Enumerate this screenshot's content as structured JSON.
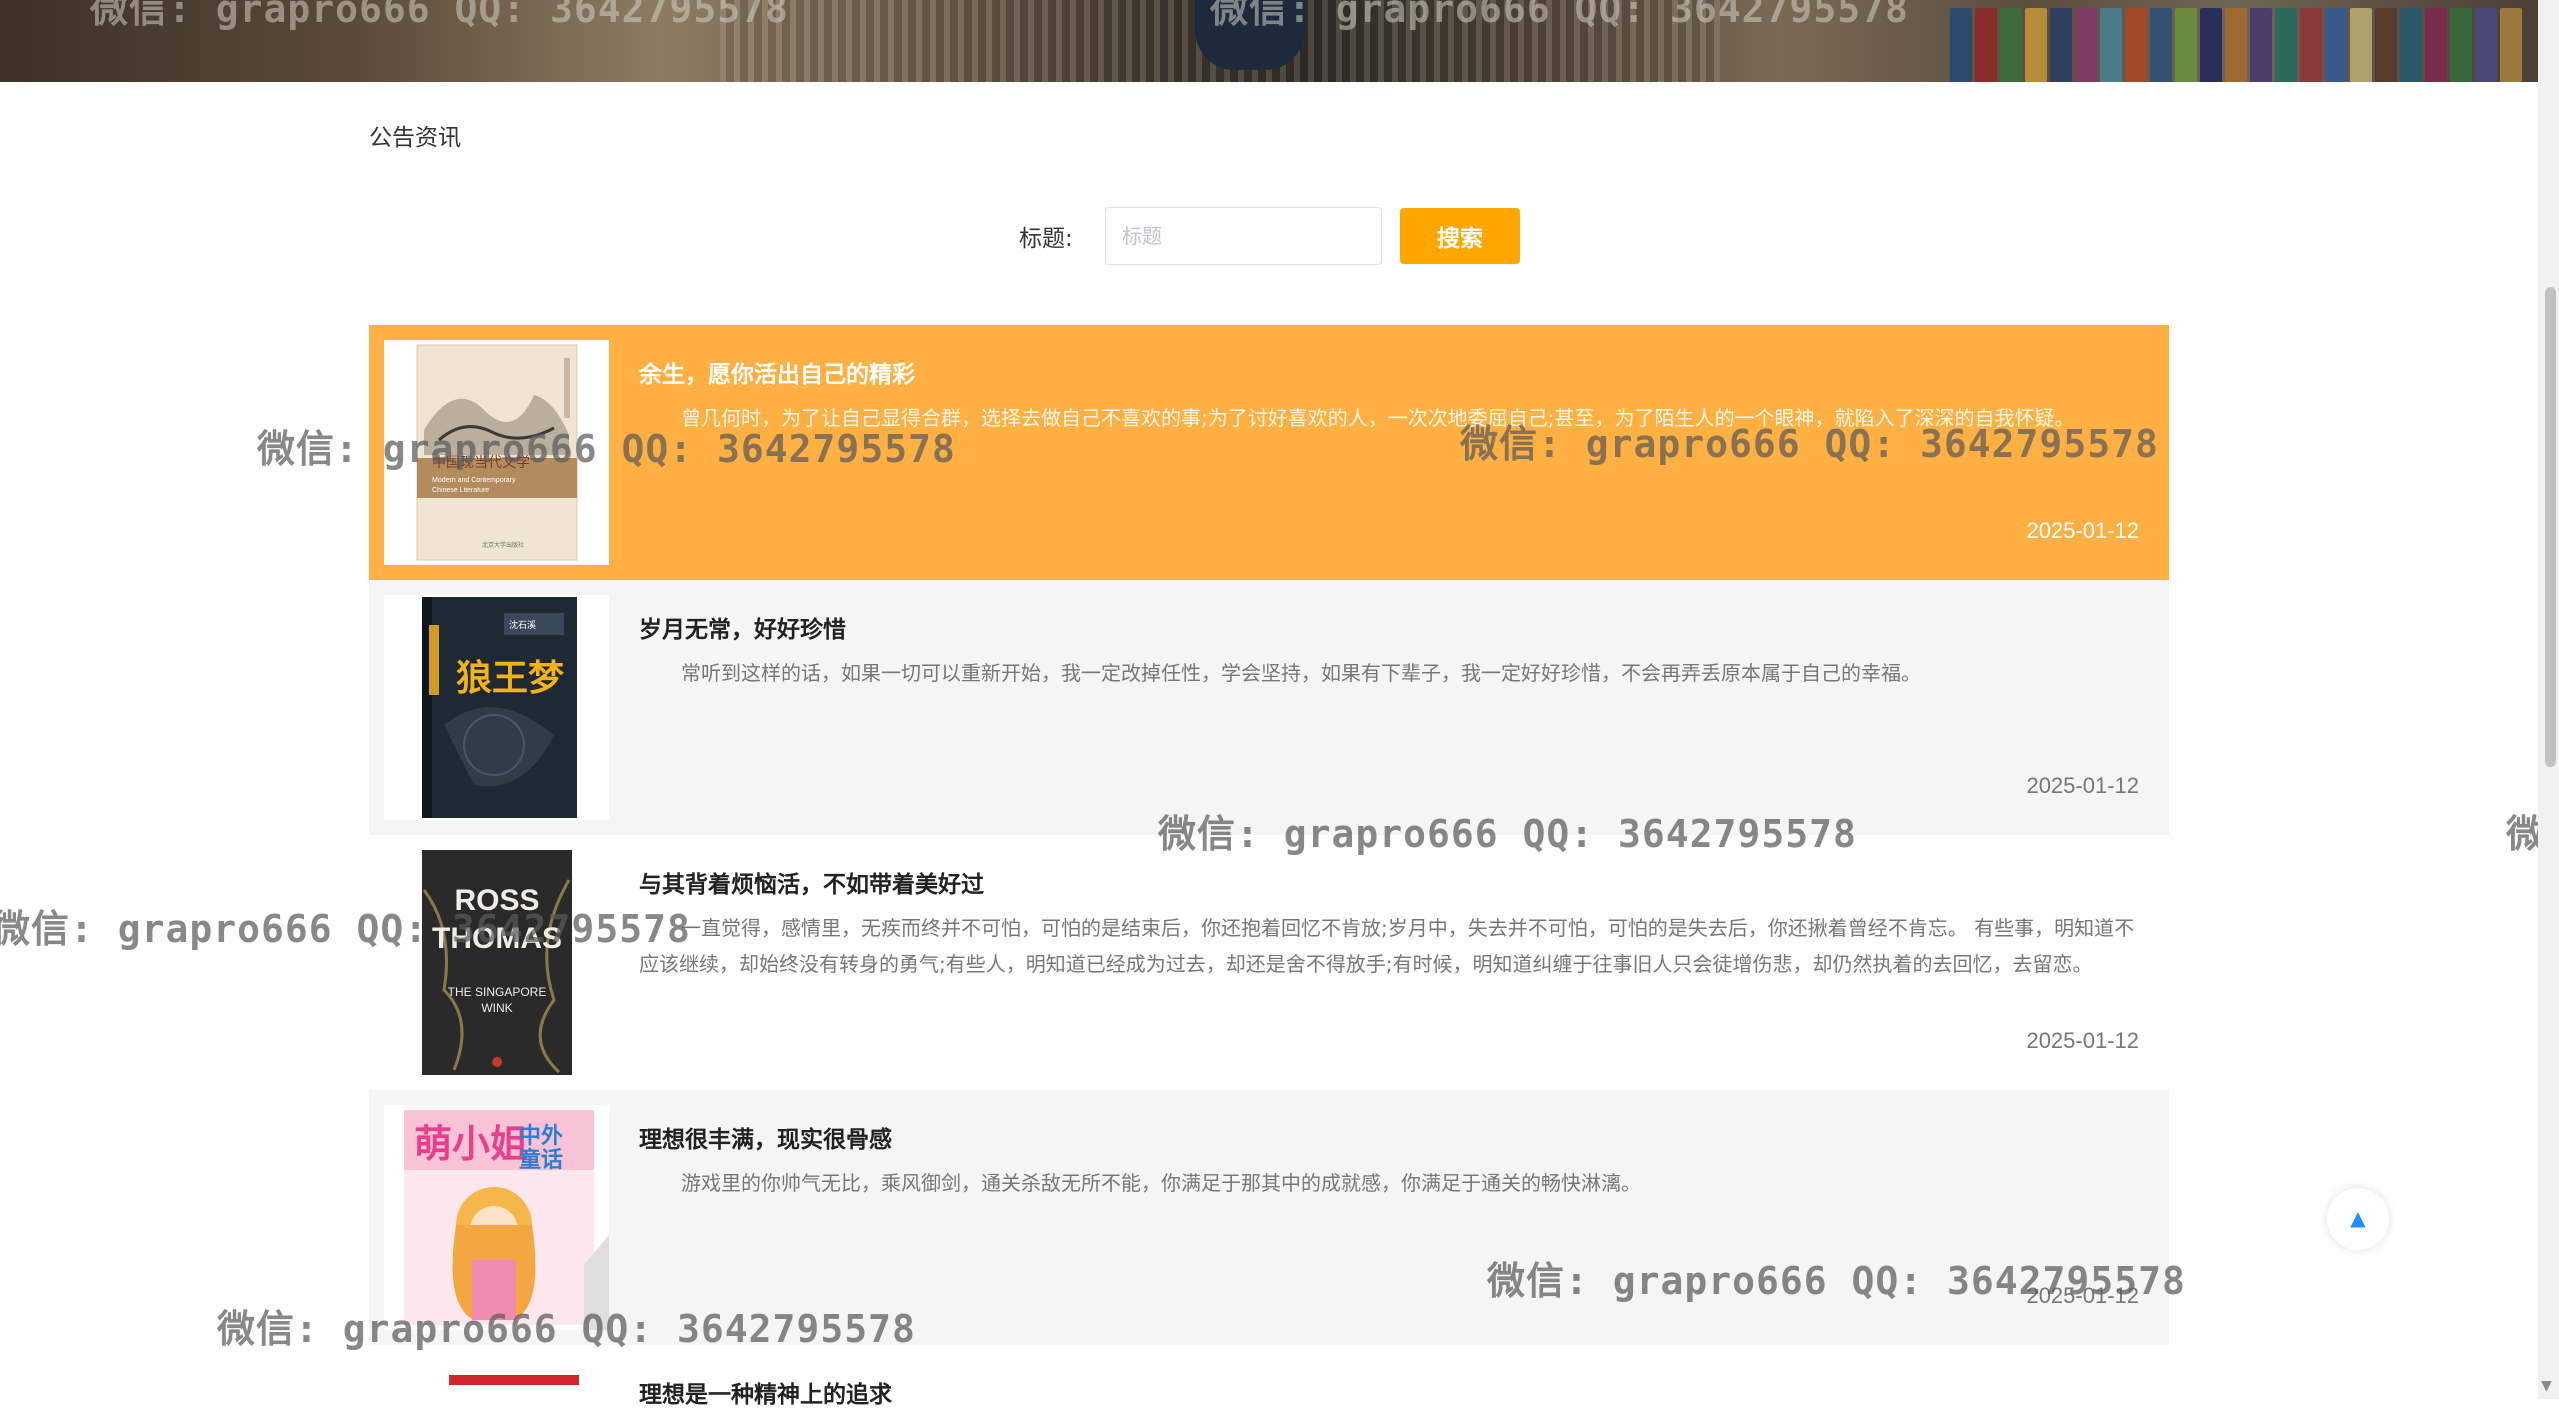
{
  "section_title": "公告资讯",
  "search": {
    "label": "标题:",
    "placeholder": "标题",
    "value": "",
    "button_label": "搜索"
  },
  "articles": [
    {
      "title": "余生，愿你活出自己的精彩",
      "summary": "曾几何时，为了让自己显得合群，选择去做自己不喜欢的事;为了讨好喜欢的人，一次次地委屈自己;甚至，为了陌生人的一个眼神，就陷入了深深的自我怀疑。",
      "date": "2025-01-12",
      "cover_title": "中国现当代文学",
      "cover_subtitle": "Modern and Contemporary Chinese Literature",
      "highlighted": true
    },
    {
      "title": "岁月无常，好好珍惜",
      "summary": "常听到这样的话，如果一切可以重新开始，我一定改掉任性，学会坚持，如果有下辈子，我一定好好珍惜，不会再弄丢原本属于自己的幸福。",
      "date": "2025-01-12",
      "cover_title": "狼王梦",
      "highlighted": false
    },
    {
      "title": "与其背着烦恼活，不如带着美好过",
      "summary": "一直觉得，感情里，无疾而终并不可怕，可怕的是结束后，你还抱着回忆不肯放;岁月中，失去并不可怕，可怕的是失去后，你还揪着曾经不肯忘。 有些事，明知道不应该继续，却始终没有转身的勇气;有些人，明知道已经成为过去，却还是舍不得放手;有时候，明知道纠缠于往事旧人只会徒增伤悲，却仍然执着的去回忆，去留恋。",
      "date": "2025-01-12",
      "cover_title": "ROSS THOMAS",
      "cover_subtitle": "THE SINGAPORE WINK",
      "highlighted": false
    },
    {
      "title": "理想很丰满，现实很骨感",
      "summary": "游戏里的你帅气无比，乘风御剑，通关杀敌无所不能，你满足于那其中的成就感，你满足于通关的畅快淋漓。",
      "date": "2025-01-12",
      "cover_title": "萌小姐",
      "cover_subtitle": "中外童话",
      "highlighted": false
    },
    {
      "title": "理想是一种精神上的追求",
      "highlighted": false
    }
  ],
  "watermark_text": "微信: grapro666 QQ: 3642795578",
  "colors": {
    "accent": "#ffa700",
    "highlight_row": "#ffb043",
    "row_bg": "#f5f5f5",
    "backtop_arrow": "#1e90ff"
  }
}
